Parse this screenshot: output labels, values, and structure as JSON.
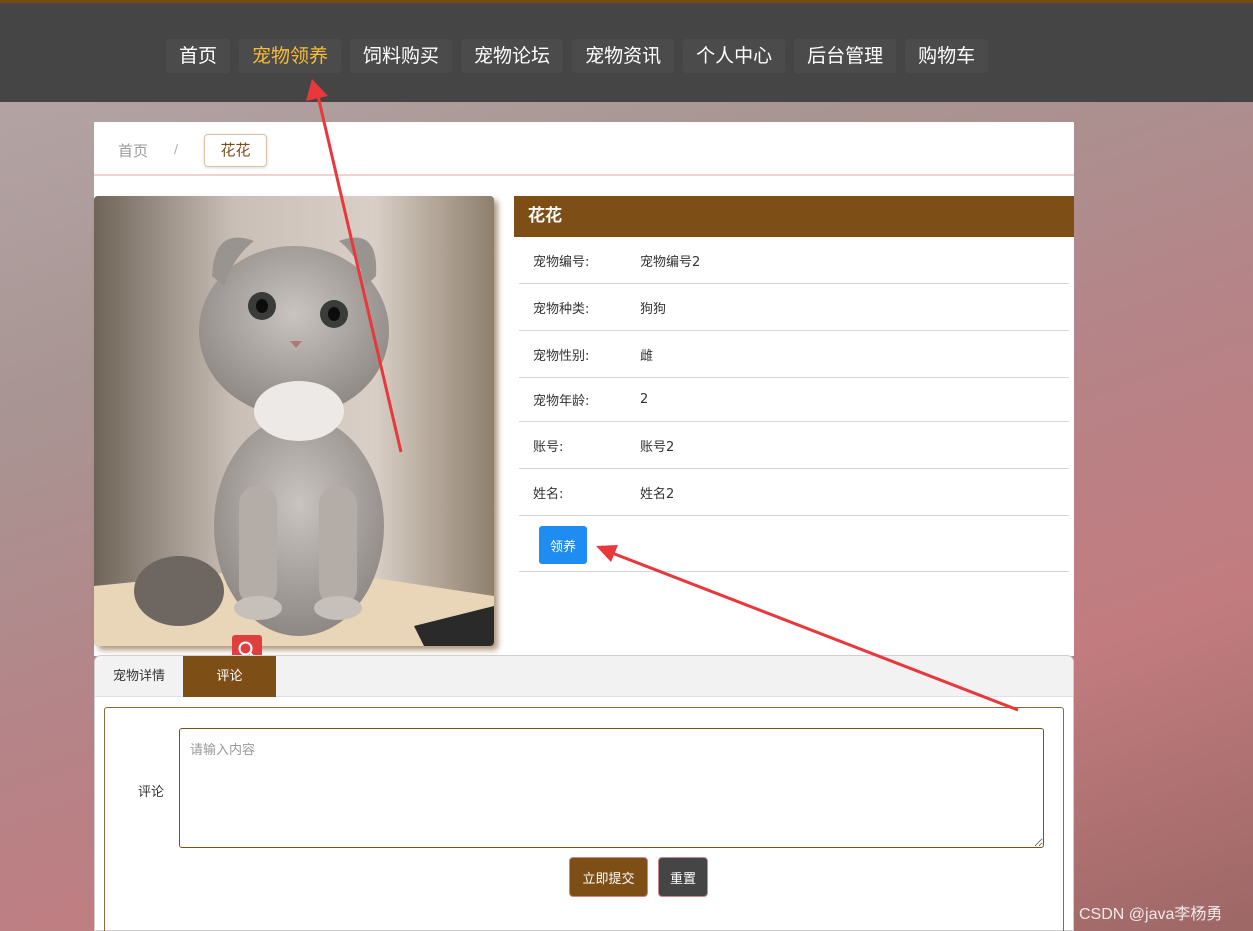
{
  "nav": {
    "items": [
      "首页",
      "宠物领养",
      "饲料购买",
      "宠物论坛",
      "宠物资讯",
      "个人中心",
      "后台管理",
      "购物车"
    ],
    "active_index": 1,
    "active_color": "#f7bc38"
  },
  "breadcrumb": {
    "home": "首页",
    "separator": "/",
    "current": "花花"
  },
  "pet": {
    "name": "花花",
    "fields": [
      {
        "label": "宠物编号:",
        "value": "宠物编号2"
      },
      {
        "label": "宠物种类:",
        "value": "狗狗"
      },
      {
        "label": "宠物性别:",
        "value": "雌"
      },
      {
        "label": "宠物年龄:",
        "value": "2"
      },
      {
        "label": "账号:",
        "value": "账号2"
      },
      {
        "label": "姓名:",
        "value": "姓名2"
      }
    ],
    "adopt_label": "领养",
    "image_icon": "cat-photo"
  },
  "tabs": {
    "items": [
      "宠物详情",
      "评论"
    ],
    "active_index": 1
  },
  "comment": {
    "label": "评论",
    "placeholder": "请输入内容",
    "submit_label": "立即提交",
    "reset_label": "重置"
  },
  "colors": {
    "brand": "#7d4f17",
    "topbar": "#454545",
    "adopt": "#1e8cf0",
    "annotation": "#e8383b"
  },
  "watermark": "CSDN @java李杨勇"
}
